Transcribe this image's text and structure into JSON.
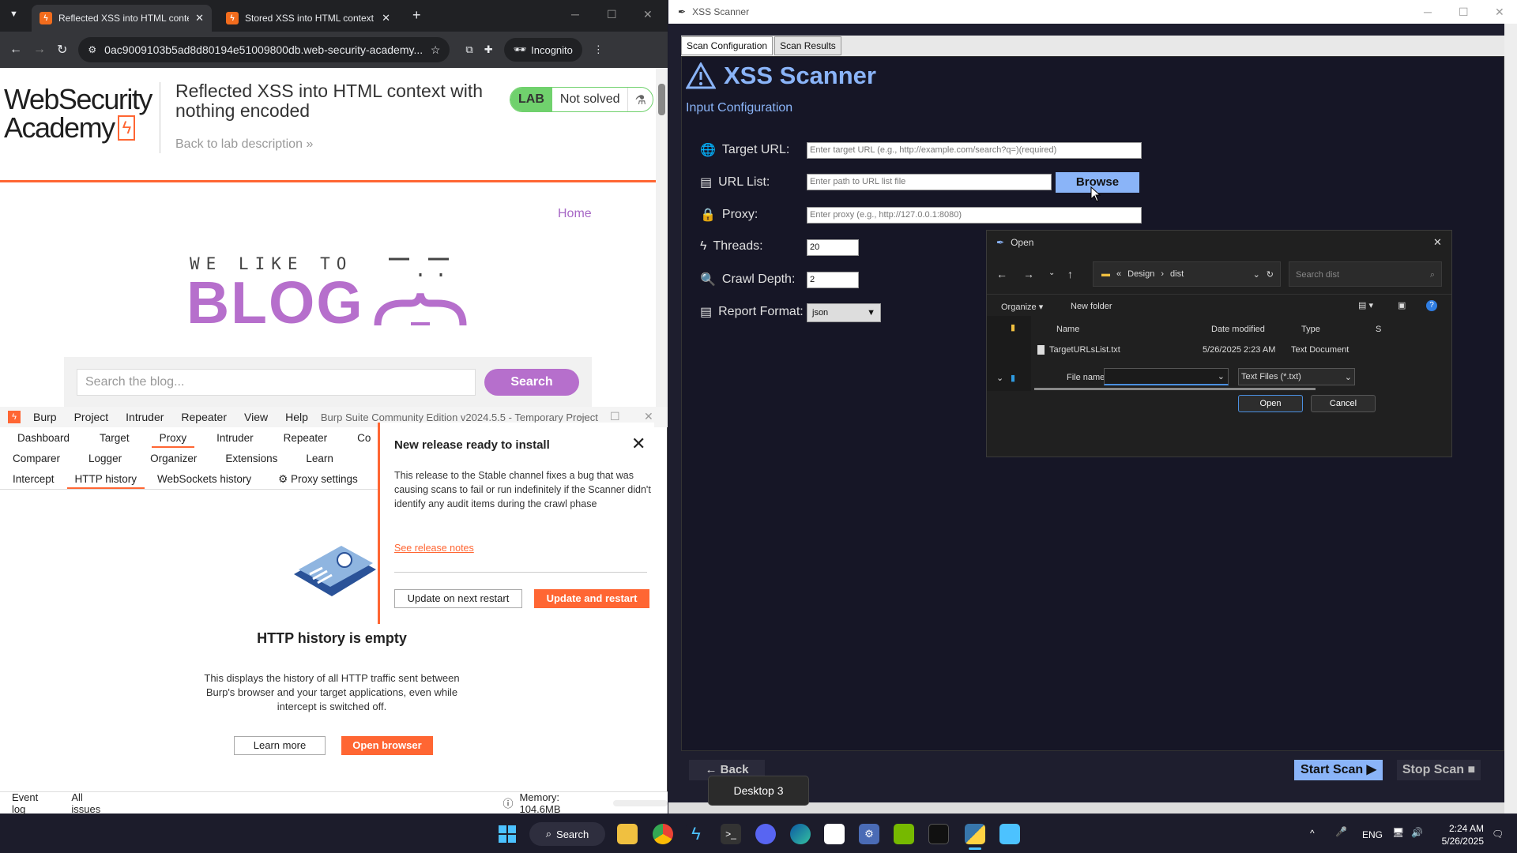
{
  "chrome": {
    "tabs": [
      {
        "title": "Reflected XSS into HTML conte",
        "favicon_color": "#f26c1d"
      },
      {
        "title": "Stored XSS into HTML context",
        "favicon_color": "#f26c1d"
      }
    ],
    "url": "0ac9009103b5ad8d80194e51009800db.web-security-academy....",
    "incognito_label": "Incognito"
  },
  "wsa": {
    "logo_line1": "WebSecurity",
    "logo_line2": "Academy",
    "lab_title": "Reflected XSS into HTML context with nothing encoded",
    "lab_badge": "LAB",
    "lab_status": "Not solved",
    "back_link": "Back to lab description",
    "nav_home": "Home",
    "blog_tagline": "WE LIKE TO",
    "blog_word": "BLOG",
    "search_placeholder": "Search the blog...",
    "search_button": "Search"
  },
  "burp": {
    "menu": [
      "Burp",
      "Project",
      "Intruder",
      "Repeater",
      "View",
      "Help"
    ],
    "title": "Burp Suite Community Edition v2024.5.5 - Temporary Project",
    "tabs_row1": [
      "Dashboard",
      "Target",
      "Proxy",
      "Intruder",
      "Repeater",
      "Co"
    ],
    "tabs_row2": [
      "Comparer",
      "Logger",
      "Organizer",
      "Extensions",
      "Learn"
    ],
    "subtabs": [
      "Intercept",
      "HTTP history",
      "WebSockets history"
    ],
    "proxy_settings": "Proxy settings",
    "empty_title": "HTTP history is empty",
    "empty_desc": "This displays the history of all HTTP traffic sent between Burp's browser and your target applications, even while intercept is switched off.",
    "learn_more": "Learn more",
    "open_browser": "Open browser",
    "popup": {
      "title": "New release ready to install",
      "body": "This release to the Stable channel fixes a bug that was causing scans to fail or run indefinitely if the Scanner didn't identify any audit items during the crawl phase",
      "link": "See release notes",
      "btn_later": "Update on next restart",
      "btn_now": "Update and restart"
    },
    "status": {
      "event_log": "Event log",
      "all_issues": "All issues",
      "memory": "Memory: 104.6MB"
    }
  },
  "xss": {
    "window_title": "XSS Scanner",
    "tabs": [
      "Scan Configuration",
      "Scan Results"
    ],
    "heading": "XSS Scanner",
    "section": "Input Configuration",
    "fields": {
      "target_label": "Target URL:",
      "target_placeholder": "Enter target URL (e.g., http://example.com/search?q=)(required)",
      "urllist_label": "URL List:",
      "urllist_placeholder": "Enter path to URL list file",
      "browse": "Browse",
      "proxy_label": "Proxy:",
      "proxy_placeholder": "Enter proxy (e.g., http://127.0.0.1:8080)",
      "threads_label": "Threads:",
      "threads_value": "20",
      "depth_label": "Crawl Depth:",
      "depth_value": "2",
      "format_label": "Report Format:",
      "format_value": "json"
    },
    "back": "← Back",
    "start_scan": "Start Scan",
    "stop_scan": "Stop Scan",
    "accent": "#8ab4f8"
  },
  "dialog": {
    "title": "Open",
    "path_parent": "Design",
    "path_current": "dist",
    "search_placeholder": "Search dist",
    "organize": "Organize",
    "new_folder": "New folder",
    "columns": [
      "Name",
      "Date modified",
      "Type",
      "S"
    ],
    "files": [
      {
        "name": "TargetURLsList.txt",
        "modified": "5/26/2025 2:23 AM",
        "type": "Text Document"
      }
    ],
    "file_name_label": "File name:",
    "file_type": "Text Files (*.txt)",
    "open": "Open",
    "cancel": "Cancel"
  },
  "tooltip": "Desktop 3",
  "taskbar": {
    "search": "Search",
    "lang": "ENG",
    "time": "2:24 AM",
    "date": "5/26/2025"
  }
}
